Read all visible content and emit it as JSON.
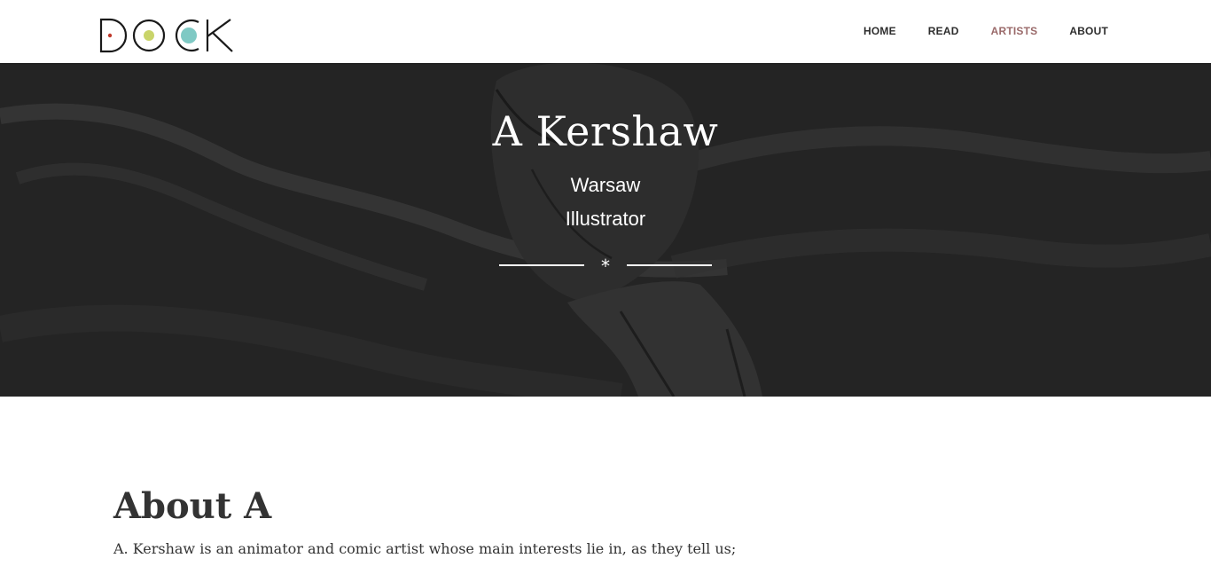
{
  "header": {
    "logo_text": "DOCK",
    "nav": [
      {
        "label": "HOME",
        "active": false
      },
      {
        "label": "READ",
        "active": false
      },
      {
        "label": "ARTISTS",
        "active": true
      },
      {
        "label": "ABOUT",
        "active": false
      }
    ]
  },
  "hero": {
    "title": "A Kershaw",
    "city": "Warsaw",
    "role": "Illustrator",
    "divider_glyph": "*"
  },
  "about": {
    "heading": "About A",
    "intro": "A. Kershaw is an animator and comic artist whose main interests lie in, as they tell us;"
  },
  "colors": {
    "nav_active": "#9a6a6a",
    "hero_bg": "#2b2b2b",
    "logo_dot_green": "#c9d46a",
    "logo_dot_teal": "#7fc9c4",
    "logo_dot_red": "#c0392b"
  }
}
